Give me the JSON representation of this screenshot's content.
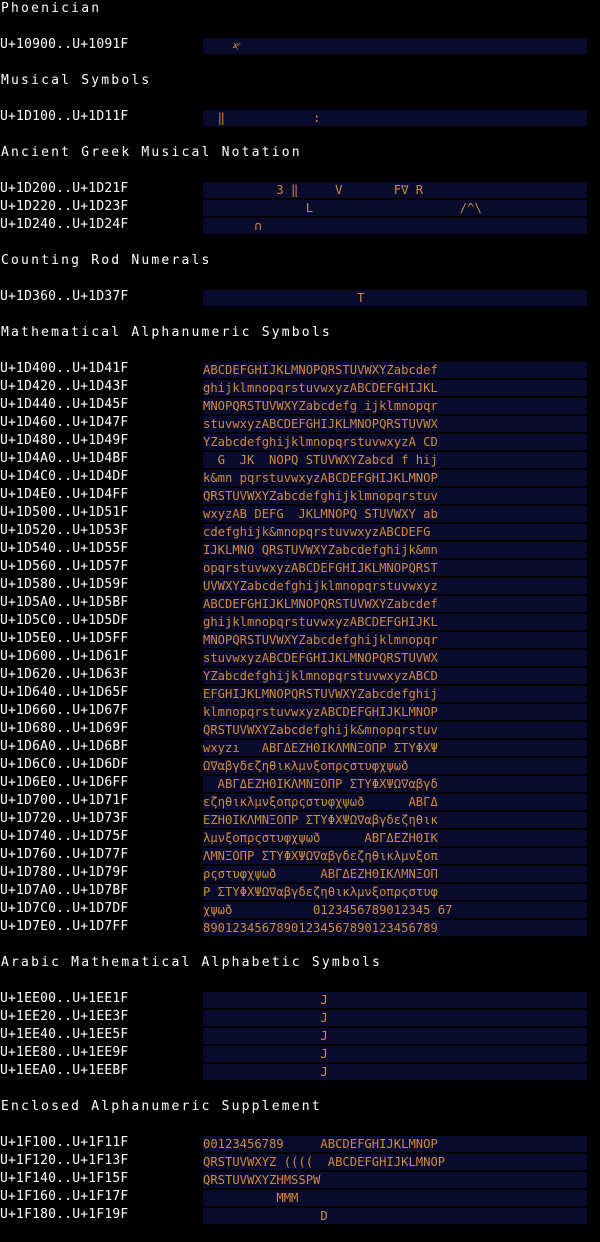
{
  "colors": {
    "background": "#000000",
    "label_text": "#ffffff",
    "glyph_text": "#d28a3c",
    "glyph_bg": "#080a2e"
  },
  "sections": [
    {
      "heading": "Phoenician",
      "rows": [
        {
          "range": "U+10900..U+1091F",
          "glyphs": "    𐤀"
        }
      ]
    },
    {
      "heading": "Musical Symbols",
      "rows": [
        {
          "range": "U+1D100..U+1D11F",
          "glyphs": "  ‖            :"
        }
      ]
    },
    {
      "heading": "Ancient Greek Musical Notation",
      "rows": [
        {
          "range": "U+1D200..U+1D21F",
          "glyphs": "          3 ‖     V       F∇ R"
        },
        {
          "range": "U+1D220..U+1D23F",
          "glyphs": "              L                    /^\\"
        },
        {
          "range": "U+1D240..U+1D24F",
          "glyphs": "       ∩"
        }
      ]
    },
    {
      "heading": "Counting Rod Numerals",
      "rows": [
        {
          "range": "U+1D360..U+1D37F",
          "glyphs": "                     T"
        }
      ]
    },
    {
      "heading": "Mathematical Alphanumeric Symbols",
      "rows": [
        {
          "range": "U+1D400..U+1D41F",
          "glyphs": "ABCDEFGHIJKLMNOPQRSTUVWXYZabcdef"
        },
        {
          "range": "U+1D420..U+1D43F",
          "glyphs": "ghijklmnopqrstuvwxyzABCDEFGHIJKL"
        },
        {
          "range": "U+1D440..U+1D45F",
          "glyphs": "MNOPQRSTUVWXYZabcdefg ijklmnopqr"
        },
        {
          "range": "U+1D460..U+1D47F",
          "glyphs": "stuvwxyzABCDEFGHIJKLMNOPQRSTUVWX"
        },
        {
          "range": "U+1D480..U+1D49F",
          "glyphs": "YZabcdefghijklmnopqrstuvwxyzA CD"
        },
        {
          "range": "U+1D4A0..U+1D4BF",
          "glyphs": "  G  JK  NOPQ STUVWXYZabcd f hij"
        },
        {
          "range": "U+1D4C0..U+1D4DF",
          "glyphs": "k&mn pqrstuvwxyzABCDEFGHIJKLMNOP"
        },
        {
          "range": "U+1D4E0..U+1D4FF",
          "glyphs": "QRSTUVWXYZabcdefghijklmnopqrstuv"
        },
        {
          "range": "U+1D500..U+1D51F",
          "glyphs": "wxyzAB DEFG  JKLMNOPQ STUVWXY ab"
        },
        {
          "range": "U+1D520..U+1D53F",
          "glyphs": "cdefghijk&mnopqrstuvwxyzABCDEFG"
        },
        {
          "range": "U+1D540..U+1D55F",
          "glyphs": "IJKLMNO QRSTUVWXYZabcdefghijk&mn"
        },
        {
          "range": "U+1D560..U+1D57F",
          "glyphs": "opqrstuvwxyzABCDEFGHIJKLMNOPQRST"
        },
        {
          "range": "U+1D580..U+1D59F",
          "glyphs": "UVWXYZabcdefghijklmnopqrstuvwxyz"
        },
        {
          "range": "U+1D5A0..U+1D5BF",
          "glyphs": "ABCDEFGHIJKLMNOPQRSTUVWXYZabcdef"
        },
        {
          "range": "U+1D5C0..U+1D5DF",
          "glyphs": "ghijklmnopqrstuvwxyzABCDEFGHIJKL"
        },
        {
          "range": "U+1D5E0..U+1D5FF",
          "glyphs": "MNOPQRSTUVWXYZabcdefghijklmnopqr"
        },
        {
          "range": "U+1D600..U+1D61F",
          "glyphs": "stuvwxyzABCDEFGHIJKLMNOPQRSTUVWX"
        },
        {
          "range": "U+1D620..U+1D63F",
          "glyphs": "YZabcdefghijklmnopqrstuvwxyzABCD"
        },
        {
          "range": "U+1D640..U+1D65F",
          "glyphs": "EFGHIJKLMNOPQRSTUVWXYZabcdefghij"
        },
        {
          "range": "U+1D660..U+1D67F",
          "glyphs": "klmnopqrstuvwxyzABCDEFGHIJKLMNOP"
        },
        {
          "range": "U+1D680..U+1D69F",
          "glyphs": "QRSTUVWXYZabcdefghijk&mnopqrstuv"
        },
        {
          "range": "U+1D6A0..U+1D6BF",
          "glyphs": "wxyzı   ΑΒΓΔΕΖΗΘΙΚΛΜΝΞΟΠΡ ΣΤΥΦΧΨ"
        },
        {
          "range": "U+1D6C0..U+1D6DF",
          "glyphs": "Ω∇αβγδεζηθικλμνξοπρςστυφχψωð"
        },
        {
          "range": "U+1D6E0..U+1D6FF",
          "glyphs": "  ΑΒΓΔΕΖΗΘΙΚΛΜΝΞΟΠΡ ΣΤΥΦΧΨΩ∇αβγδ"
        },
        {
          "range": "U+1D700..U+1D71F",
          "glyphs": "εζηθικλμνξοπρςστυφχψωð      ΑΒΓΔ"
        },
        {
          "range": "U+1D720..U+1D73F",
          "glyphs": "ΕΖΗΘΙΚΛΜΝΞΟΠΡ ΣΤΥΦΧΨΩ∇αβγδεζηθικ"
        },
        {
          "range": "U+1D740..U+1D75F",
          "glyphs": "λμνξοπρςστυφχψωð      ΑΒΓΔΕΖΗΘΙΚ"
        },
        {
          "range": "U+1D760..U+1D77F",
          "glyphs": "ΛΜΝΞΟΠΡ ΣΤΥΦΧΨΩ∇αβγδεζηθικλμνξοπ"
        },
        {
          "range": "U+1D780..U+1D79F",
          "glyphs": "ρςστυφχψωð      ΑΒΓΔΕΖΗΘΙΚΛΜΝΞΟΠ"
        },
        {
          "range": "U+1D7A0..U+1D7BF",
          "glyphs": "Ρ ΣΤΥΦΧΨΩ∇αβγδεζηθικλμνξοπρςστυφ"
        },
        {
          "range": "U+1D7C0..U+1D7DF",
          "glyphs": "χψωð           0123456789012345 67"
        },
        {
          "range": "U+1D7E0..U+1D7FF",
          "glyphs": "89012345678901234567890123456789"
        }
      ]
    },
    {
      "heading": "Arabic Mathematical Alphabetic Symbols",
      "rows": [
        {
          "range": "U+1EE00..U+1EE1F",
          "glyphs": "                J"
        },
        {
          "range": "U+1EE20..U+1EE3F",
          "glyphs": "                J"
        },
        {
          "range": "U+1EE40..U+1EE5F",
          "glyphs": "                J"
        },
        {
          "range": "U+1EE80..U+1EE9F",
          "glyphs": "                J"
        },
        {
          "range": "U+1EEA0..U+1EEBF",
          "glyphs": "                J"
        }
      ]
    },
    {
      "heading": "Enclosed Alphanumeric Supplement",
      "rows": [
        {
          "range": "U+1F100..U+1F11F",
          "glyphs": "00123456789     ABCDEFGHIJKLMNOP"
        },
        {
          "range": "U+1F120..U+1F13F",
          "glyphs": "QRSTUVWXYZ ((((  ABCDEFGHIJKLMNOP"
        },
        {
          "range": "U+1F140..U+1F15F",
          "glyphs": "QRSTUVWXYZHMSSPW"
        },
        {
          "range": "U+1F160..U+1F17F",
          "glyphs": "          MMM"
        },
        {
          "range": "U+1F180..U+1F19F",
          "glyphs": "                D"
        }
      ]
    }
  ]
}
